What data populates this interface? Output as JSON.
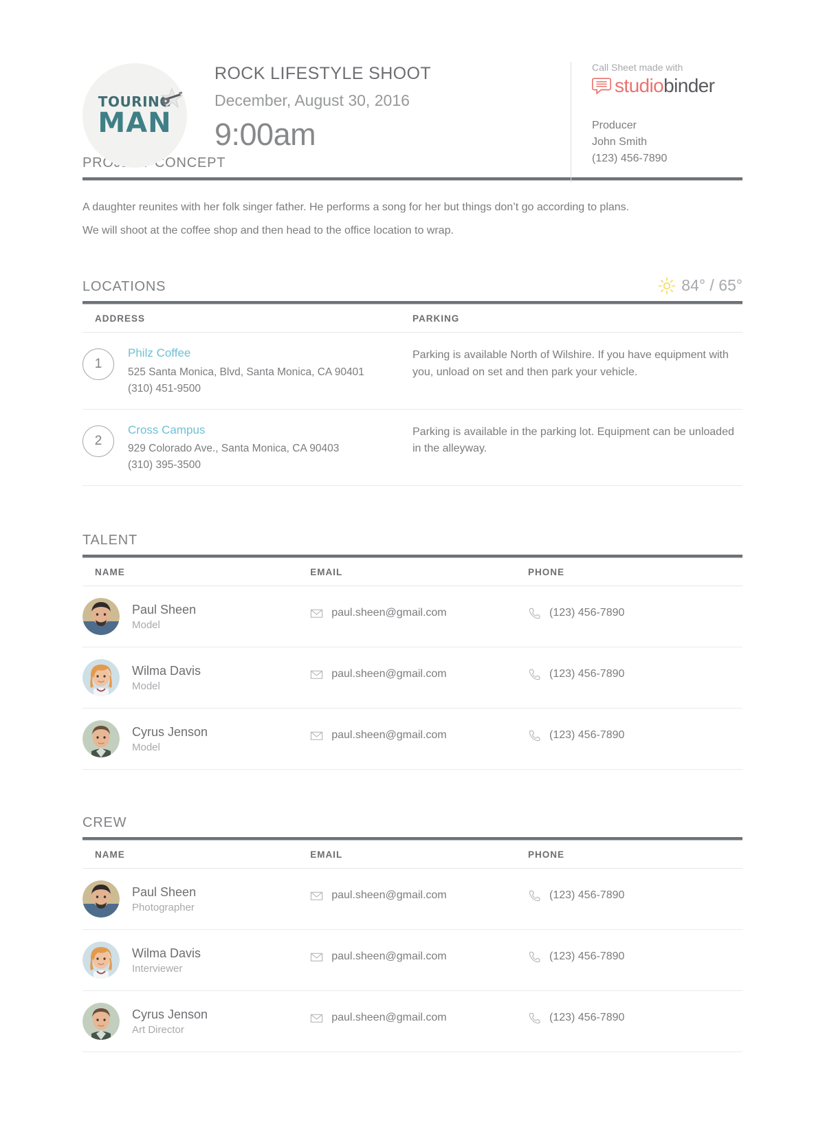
{
  "header": {
    "logo": {
      "line1": "TOURING",
      "line2": "MAN",
      "icon": "guitar-star-icon"
    },
    "project_title": "ROCK LIFESTYLE SHOOT",
    "project_date": "December, August 30, 2016",
    "call_time": "9:00am",
    "made_with_label": "Call Sheet made with",
    "brand": {
      "part1": "studio",
      "part2": "binder",
      "part1_color": "#e8746e",
      "part2_color": "#58595b",
      "icon": "studiobinder-speech-bubble-icon"
    },
    "producer": {
      "role": "Producer",
      "name": "John Smith",
      "phone": "(123) 456-7890"
    }
  },
  "concept": {
    "title": "PROJECT CONCEPT",
    "paragraphs": [
      "A daughter reunites with her folk singer father. He performs a song for her but things don’t go according to plans.",
      "We will shoot at the coffee shop and then head to the office location to wrap."
    ]
  },
  "locations": {
    "title": "LOCATIONS",
    "weather": {
      "icon": "sun-icon",
      "icon_color": "#f5dd5d",
      "high": "84°",
      "separator": "/",
      "low": "65°",
      "text": "84° / 65°"
    },
    "columns": [
      "ADDRESS",
      "PARKING"
    ],
    "rows": [
      {
        "number": "1",
        "name": "Philz Coffee",
        "address": "525 Santa Monica, Blvd, Santa Monica, CA 90401",
        "phone": "(310) 451-9500",
        "parking": "Parking is available North of Wilshire.  If you have equipment with you, unload on set and then park your vehicle."
      },
      {
        "number": "2",
        "name": "Cross Campus",
        "address": "929 Colorado Ave., Santa Monica, CA 90403",
        "phone": "(310) 395-3500",
        "parking": "Parking is available in the parking lot. Equipment can be unloaded in the alleyway."
      }
    ]
  },
  "talent": {
    "title": "TALENT",
    "columns": [
      "NAME",
      "EMAIL",
      "PHONE"
    ],
    "rows": [
      {
        "avatar": "avatar-paul-sheen",
        "name": "Paul Sheen",
        "role": "Model",
        "email": "paul.sheen@gmail.com",
        "phone": "(123) 456-7890"
      },
      {
        "avatar": "avatar-wilma-davis",
        "name": "Wilma Davis",
        "role": "Model",
        "email": "paul.sheen@gmail.com",
        "phone": "(123) 456-7890"
      },
      {
        "avatar": "avatar-cyrus-jenson",
        "name": "Cyrus Jenson",
        "role": "Model",
        "email": "paul.sheen@gmail.com",
        "phone": "(123) 456-7890"
      }
    ]
  },
  "crew": {
    "title": "CREW",
    "columns": [
      "NAME",
      "EMAIL",
      "PHONE"
    ],
    "rows": [
      {
        "avatar": "avatar-paul-sheen",
        "name": "Paul Sheen",
        "role": "Photographer",
        "email": "paul.sheen@gmail.com",
        "phone": "(123) 456-7890"
      },
      {
        "avatar": "avatar-wilma-davis",
        "name": "Wilma Davis",
        "role": "Interviewer",
        "email": "paul.sheen@gmail.com",
        "phone": "(123) 456-7890"
      },
      {
        "avatar": "avatar-cyrus-jenson",
        "name": "Cyrus Jenson",
        "role": "Art Director",
        "email": "paul.sheen@gmail.com",
        "phone": "(123) 456-7890"
      }
    ]
  }
}
